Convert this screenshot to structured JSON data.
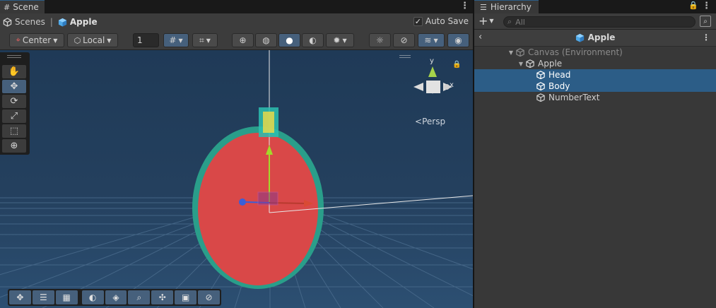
{
  "scene_tab": {
    "label": "Scene"
  },
  "breadcrumb": {
    "root": "Scenes",
    "current": "Apple"
  },
  "autosave": {
    "label": "Auto Save",
    "checked": true
  },
  "toolbar": {
    "pivot_mode": "Center",
    "pivot_rotation": "Local",
    "grid_size": "1"
  },
  "gizmo": {
    "projection_label": "Persp",
    "y_label": "y",
    "x_label": "x"
  },
  "hierarchy": {
    "tab_label": "Hierarchy",
    "search_placeholder": "All",
    "prefab_title": "Apple",
    "items": [
      {
        "label": "Canvas (Environment)",
        "depth": 0,
        "expanded": true,
        "selected": false,
        "dim": true
      },
      {
        "label": "Apple",
        "depth": 1,
        "expanded": true,
        "selected": false,
        "dim": false
      },
      {
        "label": "Head",
        "depth": 2,
        "expanded": false,
        "selected": true,
        "dim": false
      },
      {
        "label": "Body",
        "depth": 2,
        "expanded": false,
        "selected": true,
        "dim": false
      },
      {
        "label": "NumberText",
        "depth": 2,
        "expanded": false,
        "selected": false,
        "dim": false
      }
    ]
  },
  "colors": {
    "selection": "#2c5d87",
    "viewport_bg": "#223c57",
    "apple_fill": "#d94848",
    "apple_rim": "#2a9e8a",
    "accent_blue": "#46607c"
  }
}
